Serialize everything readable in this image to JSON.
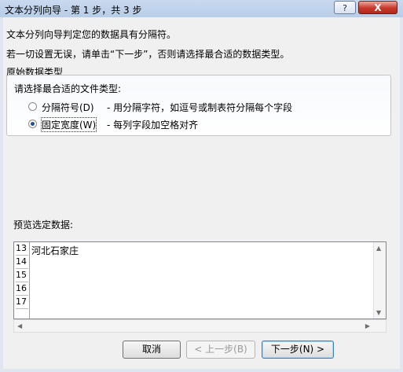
{
  "window": {
    "title": "文本分列向导 - 第 1 步，共 3 步",
    "help_label": "?",
    "close_label": "X"
  },
  "wizard": {
    "line1": "文本分列向导判定您的数据具有分隔符。",
    "line2": "若一切设置无误，请单击“下一步”，否则请选择最合适的数据类型。"
  },
  "group": {
    "title": "原始数据类型",
    "subtitle": "请选择最合适的文件类型:",
    "options": [
      {
        "label": "分隔符号(D)",
        "desc": "- 用分隔字符，如逗号或制表符分隔每个字段",
        "selected": false
      },
      {
        "label": "固定宽度(W)",
        "desc": "- 每列字段加空格对齐",
        "selected": true
      }
    ]
  },
  "preview": {
    "label": "预览选定数据:",
    "rows": [
      "13",
      "14",
      "15",
      "16",
      "17"
    ],
    "first_cell": "河北石家庄"
  },
  "buttons": {
    "cancel": "取消",
    "back": "< 上一步(B)",
    "next": "下一步(N) >"
  }
}
